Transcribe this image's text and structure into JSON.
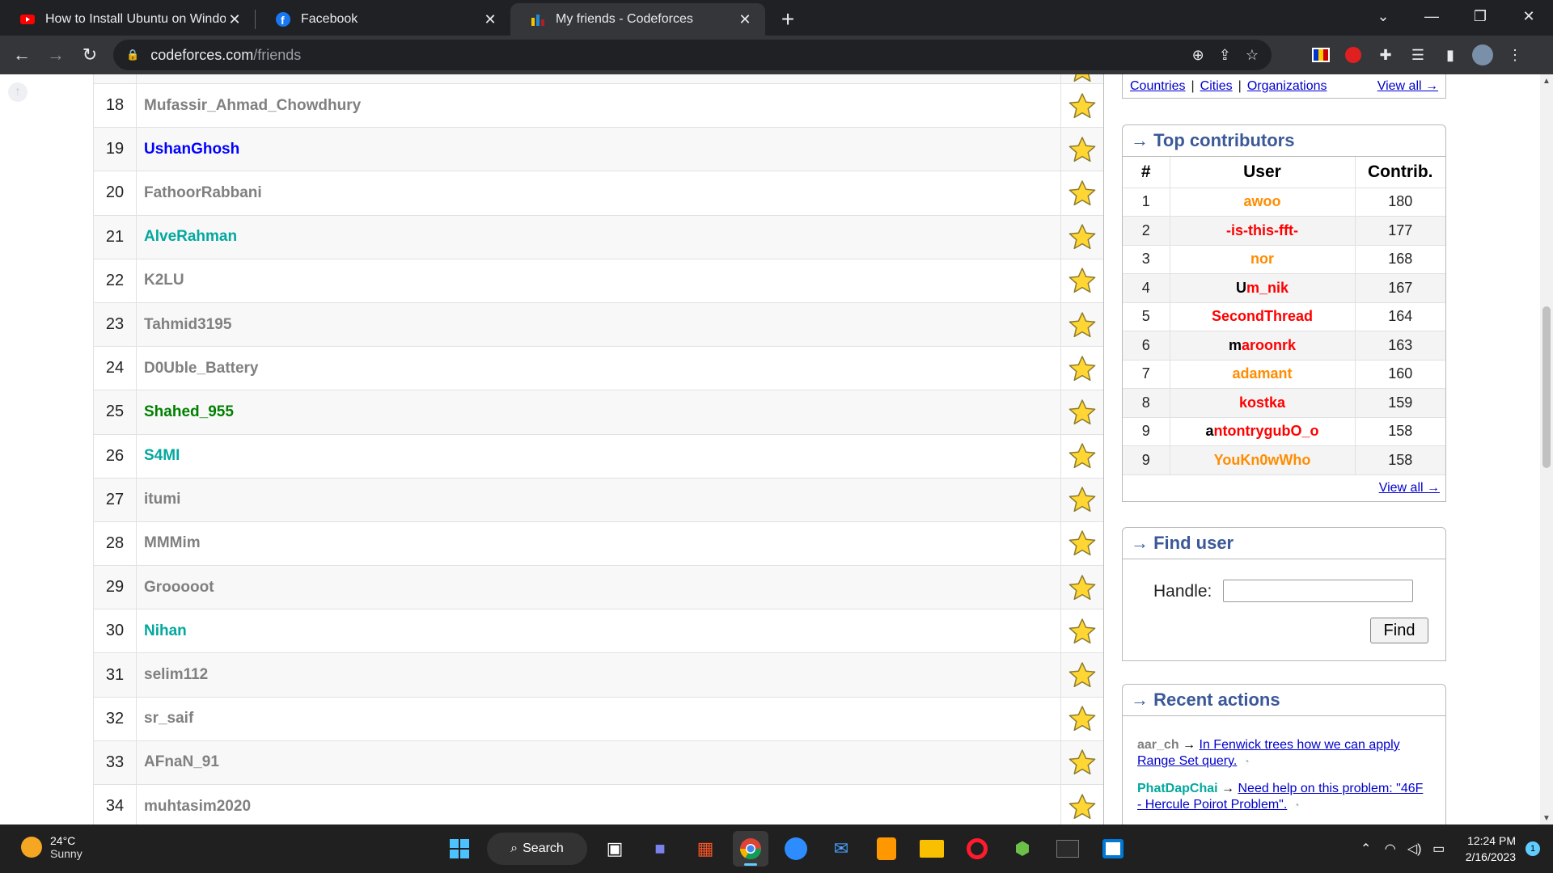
{
  "tabs": [
    {
      "title": "How to Install Ubuntu on Windo",
      "active": false
    },
    {
      "title": "Facebook",
      "active": false
    },
    {
      "title": "My friends - Codeforces",
      "active": true
    }
  ],
  "address": {
    "domain": "codeforces.com",
    "path": "/friends"
  },
  "friends": [
    {
      "num": "18",
      "handle": "Mufassir_Ahmad_Chowdhury",
      "color": "#808080"
    },
    {
      "num": "19",
      "handle": "UshanGhosh",
      "color": "#0000ff"
    },
    {
      "num": "20",
      "handle": "FathoorRabbani",
      "color": "#808080"
    },
    {
      "num": "21",
      "handle": "AlveRahman",
      "color": "#03a89e"
    },
    {
      "num": "22",
      "handle": "K2LU",
      "color": "#808080"
    },
    {
      "num": "23",
      "handle": "Tahmid3195",
      "color": "#808080"
    },
    {
      "num": "24",
      "handle": "D0Uble_Battery",
      "color": "#808080"
    },
    {
      "num": "25",
      "handle": "Shahed_955",
      "color": "#008000"
    },
    {
      "num": "26",
      "handle": "S4MI",
      "color": "#03a89e"
    },
    {
      "num": "27",
      "handle": "itumi",
      "color": "#808080"
    },
    {
      "num": "28",
      "handle": "MMMim",
      "color": "#808080"
    },
    {
      "num": "29",
      "handle": "Grooooot",
      "color": "#808080"
    },
    {
      "num": "30",
      "handle": "Nihan",
      "color": "#03a89e"
    },
    {
      "num": "31",
      "handle": "selim112",
      "color": "#808080"
    },
    {
      "num": "32",
      "handle": "sr_saif",
      "color": "#808080"
    },
    {
      "num": "33",
      "handle": "AFnaN_91",
      "color": "#808080"
    },
    {
      "num": "34",
      "handle": "muhtasim2020",
      "color": "#808080"
    }
  ],
  "rating_links": {
    "countries": "Countries",
    "cities": "Cities",
    "organizations": "Organizations",
    "view_all": "View all →"
  },
  "top_contributors": {
    "caption": "→ Top contributors",
    "headers": {
      "num": "#",
      "user": "User",
      "contrib": "Contrib."
    },
    "rows": [
      {
        "num": "1",
        "user": "awoo",
        "contrib": "180",
        "color": "#ff8c00",
        "first": ""
      },
      {
        "num": "2",
        "user": "-is-this-fft-",
        "contrib": "177",
        "color": "#ff0000",
        "first": ""
      },
      {
        "num": "3",
        "user": "nor",
        "contrib": "168",
        "color": "#ff8c00",
        "first": ""
      },
      {
        "num": "4",
        "user": "m_nik",
        "contrib": "167",
        "color": "#ff0000",
        "first": "U"
      },
      {
        "num": "5",
        "user": "SecondThread",
        "contrib": "164",
        "color": "#ff0000",
        "first": ""
      },
      {
        "num": "6",
        "user": "aroonrk",
        "contrib": "163",
        "color": "#ff0000",
        "first": "m"
      },
      {
        "num": "7",
        "user": "adamant",
        "contrib": "160",
        "color": "#ff8c00",
        "first": ""
      },
      {
        "num": "8",
        "user": "kostka",
        "contrib": "159",
        "color": "#ff0000",
        "first": ""
      },
      {
        "num": "9",
        "user": "ntontrygubO_o",
        "contrib": "158",
        "color": "#ff0000",
        "first": "a"
      },
      {
        "num": "9",
        "user": "YouKn0wWho",
        "contrib": "158",
        "color": "#ff8c00",
        "first": ""
      }
    ],
    "view_all": "View all →"
  },
  "find_user": {
    "caption": "→ Find user",
    "label": "Handle:",
    "button": "Find",
    "value": ""
  },
  "recent_actions": {
    "caption": "→ Recent actions",
    "items": [
      {
        "who": "aar_ch",
        "who_color": "#808080",
        "arrow": "→",
        "text": "In Fenwick trees how we can apply Range Set query."
      },
      {
        "who": "PhatDapChai",
        "who_color": "#03a89e",
        "arrow": "→",
        "text": "Need help on this problem: \"46F - Hercule Poirot Problem\"."
      }
    ]
  },
  "taskbar": {
    "weather_temp": "24°C",
    "weather_desc": "Sunny",
    "search": "Search",
    "time": "12:24 PM",
    "date": "2/16/2023",
    "notif_count": "1"
  }
}
